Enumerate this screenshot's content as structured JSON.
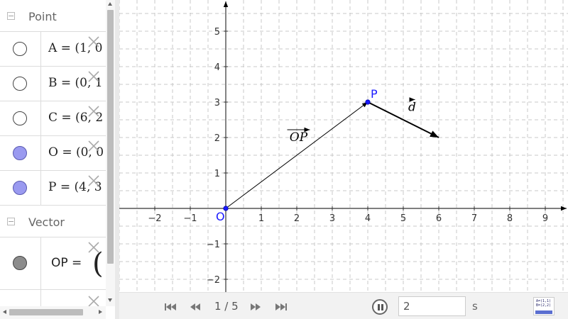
{
  "algebra": {
    "groups": [
      {
        "title": "Point",
        "collapse_symbol": "−",
        "items": [
          {
            "label": "A = (1, 0",
            "marble": "off"
          },
          {
            "label": "B = (0, 1",
            "marble": "off"
          },
          {
            "label": "C = (6, 2",
            "marble": "off"
          },
          {
            "label": "O = (0, 0",
            "marble": "on-blue"
          },
          {
            "label": "P = (4, 3",
            "marble": "on-blue"
          }
        ]
      },
      {
        "title": "Vector",
        "collapse_symbol": "−",
        "items": [
          {
            "label": "OP  =",
            "paren": "(",
            "marble": "on-gray"
          }
        ]
      }
    ],
    "delete_icon": "close-icon"
  },
  "graphics": {
    "x_ticks": [
      "−2",
      "−1",
      "1",
      "2",
      "3",
      "4",
      "5",
      "6",
      "7",
      "8",
      "9"
    ],
    "x_tick_values": [
      -2,
      -1,
      1,
      2,
      3,
      4,
      5,
      6,
      7,
      8,
      9
    ],
    "y_ticks": [
      "5",
      "4",
      "3",
      "2",
      "1",
      "−1",
      "−2"
    ],
    "y_tick_values": [
      5,
      4,
      3,
      2,
      1,
      -1,
      -2
    ],
    "origin_label": "O",
    "points": [
      {
        "name": "O",
        "label": "O",
        "x": 0,
        "y": 0
      },
      {
        "name": "P",
        "label": "P",
        "x": 4,
        "y": 3
      }
    ],
    "vectors": [
      {
        "name": "OP",
        "label": "OP",
        "from": [
          0,
          0
        ],
        "to": [
          4,
          3
        ]
      },
      {
        "name": "d",
        "label": "d",
        "from": [
          4,
          3
        ],
        "to": [
          6,
          2
        ]
      }
    ],
    "colors": {
      "point": "#1a1aff",
      "axis": "#333333",
      "grid": "#c8c8c8",
      "vector": "#000000"
    }
  },
  "toolbar": {
    "first_icon": "skip-first-icon",
    "prev_icon": "step-back-icon",
    "step_text": "1 / 5",
    "next_icon": "step-forward-icon",
    "last_icon": "skip-last-icon",
    "pause_icon": "pause-icon",
    "speed_value": "2",
    "speed_unit": "s",
    "algebra_toggle": {
      "line1": "A=(1,1)",
      "line2": "B=(2,2)",
      "line3": "a: y=x"
    }
  }
}
